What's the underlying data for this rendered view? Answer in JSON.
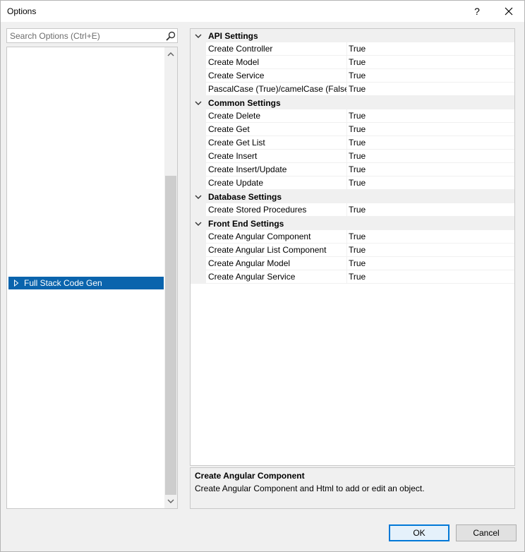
{
  "window": {
    "title": "Options",
    "help_label": "?",
    "close_label": "✕"
  },
  "search": {
    "placeholder": "Search Options (Ctrl+E)",
    "value": ""
  },
  "tree": {
    "items": [
      {
        "label": "Full Stack Code Gen",
        "selected": true,
        "expanded": false
      }
    ]
  },
  "grid": {
    "categories": [
      {
        "label": "API Settings",
        "properties": [
          {
            "name": "Create Controller",
            "value": "True"
          },
          {
            "name": "Create Model",
            "value": "True"
          },
          {
            "name": "Create Service",
            "value": "True"
          },
          {
            "name": "PascalCase (True)/camelCase (False)",
            "value": "True"
          }
        ]
      },
      {
        "label": "Common Settings",
        "properties": [
          {
            "name": "Create Delete",
            "value": "True"
          },
          {
            "name": "Create Get",
            "value": "True"
          },
          {
            "name": "Create Get List",
            "value": "True"
          },
          {
            "name": "Create Insert",
            "value": "True"
          },
          {
            "name": "Create Insert/Update",
            "value": "True"
          },
          {
            "name": "Create Update",
            "value": "True"
          }
        ]
      },
      {
        "label": "Database Settings",
        "properties": [
          {
            "name": "Create Stored Procedures",
            "value": "True"
          }
        ]
      },
      {
        "label": "Front End Settings",
        "properties": [
          {
            "name": "Create Angular Component",
            "value": "True"
          },
          {
            "name": "Create Angular List Component",
            "value": "True"
          },
          {
            "name": "Create Angular Model",
            "value": "True"
          },
          {
            "name": "Create Angular Service",
            "value": "True"
          }
        ]
      }
    ]
  },
  "description": {
    "title": "Create Angular Component",
    "text": "Create Angular Component and Html to add or edit an object."
  },
  "buttons": {
    "ok_label": "OK",
    "cancel_label": "Cancel"
  },
  "colors": {
    "selection": "#0a64ad",
    "accent": "#0078d7"
  }
}
